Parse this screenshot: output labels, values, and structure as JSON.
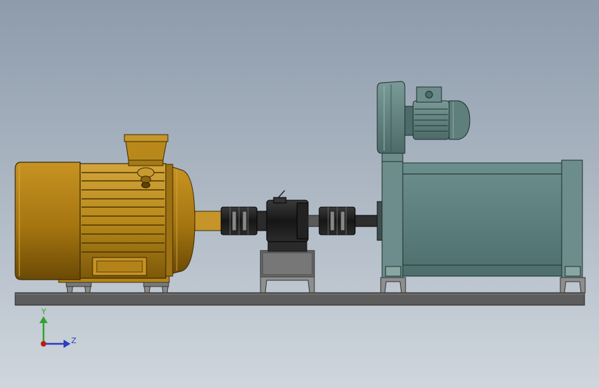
{
  "colors": {
    "motor_body": "#b8891a",
    "motor_dark": "#5e4206",
    "base_plate": "#5d5d5d",
    "coupling": "#1c1c1c",
    "stand": "#6e6e6e",
    "dyno_body": "#5a7c7a",
    "dyno_frame": "#6c8d8b",
    "blower": "#5e7f7c",
    "axis_y": "#2ea52e",
    "axis_z": "#2b3fbf",
    "axis_x": "#c01a1a"
  },
  "triad": {
    "y_label": "Y",
    "z_label": "Z"
  }
}
